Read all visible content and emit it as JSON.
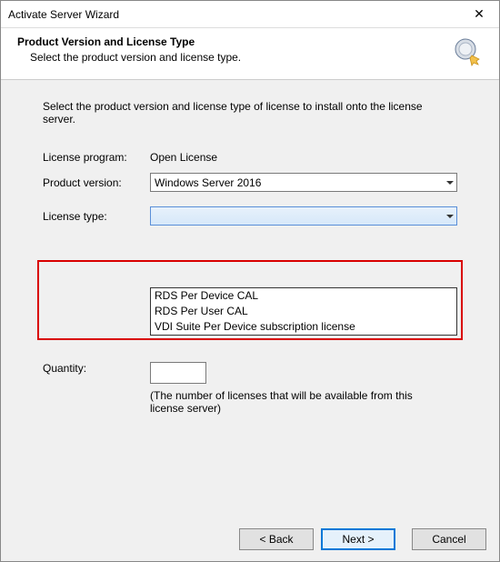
{
  "window": {
    "title": "Activate Server Wizard"
  },
  "header": {
    "title": "Product Version and License Type",
    "subtitle": "Select the product version and license type."
  },
  "content": {
    "intro": "Select the product version and license type of license to install onto the license server.",
    "license_program_label": "License program:",
    "license_program_value": "Open License",
    "product_version_label": "Product version:",
    "product_version_value": "Windows Server 2016",
    "license_type_label": "License type:",
    "license_type_value": "",
    "license_type_options": [
      "RDS Per Device CAL",
      "RDS Per User CAL",
      "VDI Suite Per Device subscription license"
    ],
    "quantity_label": "Quantity:",
    "quantity_value": "",
    "quantity_help": "(The number of licenses that will be available from this license server)"
  },
  "footer": {
    "back": "< Back",
    "next": "Next >",
    "cancel": "Cancel"
  }
}
